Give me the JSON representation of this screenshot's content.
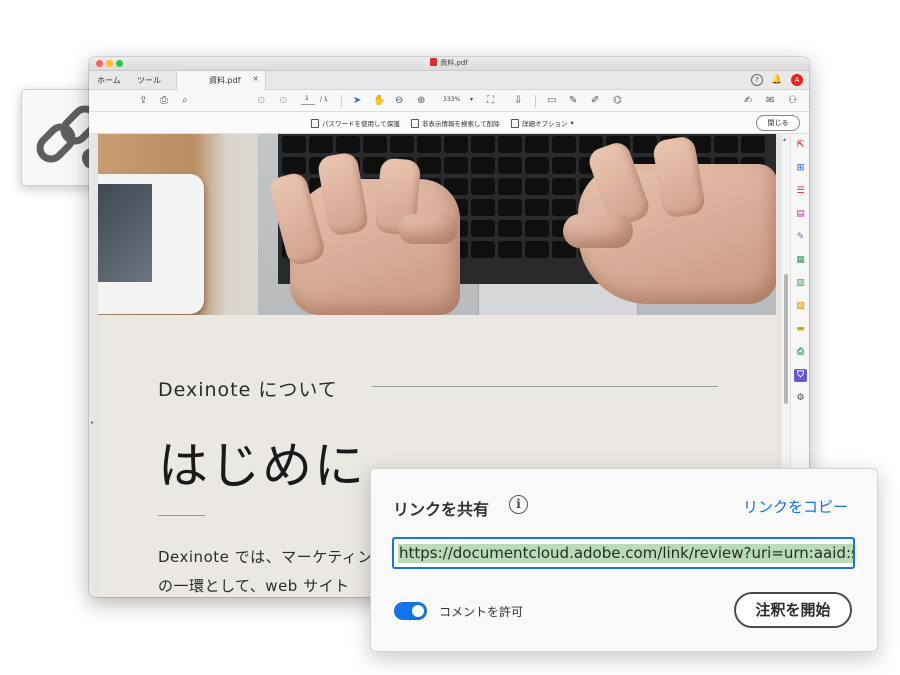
{
  "window": {
    "title": "資料.pdf",
    "tabs": {
      "home": "ホーム",
      "tools": "ツール",
      "document": "資料.pdf"
    },
    "tab_close": "×",
    "tabbar_right": {
      "help": "?",
      "notifications": "🔔",
      "acrobat": "A"
    }
  },
  "toolbar": {
    "page_current": "1",
    "page_total": "/ 1",
    "zoom": "333%"
  },
  "subtoolbar": {
    "protect_label": "パスワードを使用して保護",
    "find_hidden_label": "非表示情報を検索して削除",
    "more_options_label": "詳細オプション",
    "close_label": "閉じる"
  },
  "document": {
    "subtitle": "Dexinote について",
    "heading": "はじめに",
    "paragraph_line1": "Dexinote では、マーケティン",
    "paragraph_line2": "の一環として、web サイト"
  },
  "share_panel": {
    "title": "リンクを共有",
    "info_icon": "i",
    "copy_link_label": "リンクをコピー",
    "url": "https://documentcloud.adobe.com/link/review?uri=urn:aaid:scds:US:",
    "allow_comments_label": "コメントを許可",
    "allow_comments_on": true,
    "start_annotation_label": "注釈を開始"
  },
  "colors": {
    "accent": "#1473e6",
    "url_highlight": "#b8dcb6",
    "acrobat_red": "#e1251b",
    "active_tool": "#6b55d4",
    "link_icon_gray": "#5f5f5f"
  },
  "icons": {
    "link_card": "link-cloud-icon",
    "right_panel": [
      "export-pdf-icon",
      "create-pdf-icon",
      "organize-pages-icon",
      "edit-pdf-icon",
      "fill-sign-icon",
      "scan-ocr-icon",
      "compress-icon",
      "combine-files-icon",
      "comment-icon",
      "print-production-icon",
      "protect-icon",
      "more-tools-icon"
    ]
  }
}
